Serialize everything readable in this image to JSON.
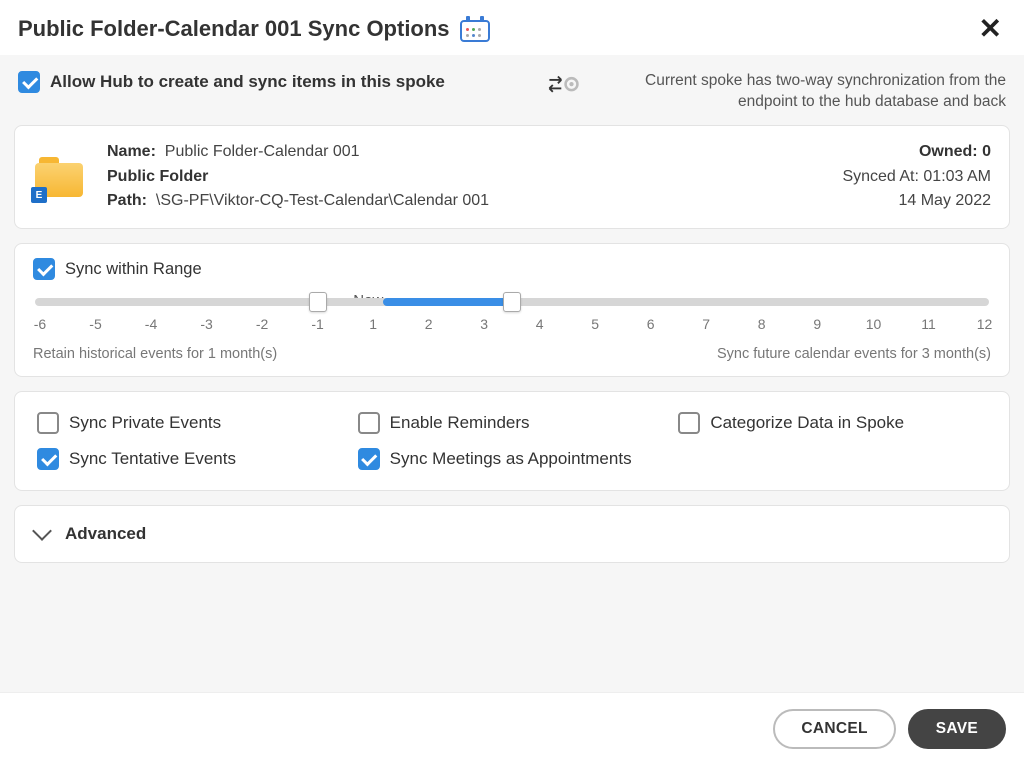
{
  "title": "Public Folder-Calendar 001 Sync Options",
  "sync_mode_desc": "Current spoke has two-way synchronization from the endpoint to the hub database and back",
  "allow_hub_label": "Allow Hub to create and sync items in this spoke",
  "allow_hub_checked": true,
  "info": {
    "name_label": "Name:",
    "name_value": "Public Folder-Calendar 001",
    "type": "Public Folder",
    "path_label": "Path:",
    "path_value": "\\SG-PF\\Viktor-CQ-Test-Calendar\\Calendar 001",
    "owned_label": "Owned:",
    "owned_value": "0",
    "synced_label": "Synced At:",
    "synced_value": "01:03 AM",
    "synced_date": "14 May 2022"
  },
  "range": {
    "label": "Sync within Range",
    "checked": true,
    "now_label": "Now",
    "ticks": [
      "-6",
      "-5",
      "-4",
      "-3",
      "-2",
      "-1",
      "1",
      "2",
      "3",
      "4",
      "5",
      "6",
      "7",
      "8",
      "9",
      "10",
      "11",
      "12"
    ],
    "min": -6,
    "max": 12,
    "handle_left": -1,
    "handle_right": 3,
    "fill_start": 0,
    "retain_text": "Retain historical events for 1 month(s)",
    "future_text": "Sync future calendar events for 3 month(s)"
  },
  "options": {
    "sync_private": {
      "label": "Sync Private Events",
      "checked": false
    },
    "sync_tentative": {
      "label": "Sync Tentative Events",
      "checked": true
    },
    "enable_reminders": {
      "label": "Enable Reminders",
      "checked": false
    },
    "sync_meetings_appt": {
      "label": "Sync Meetings as Appointments",
      "checked": true
    },
    "categorize_data": {
      "label": "Categorize Data in Spoke",
      "checked": false
    }
  },
  "advanced_label": "Advanced",
  "buttons": {
    "cancel": "CANCEL",
    "save": "SAVE"
  }
}
